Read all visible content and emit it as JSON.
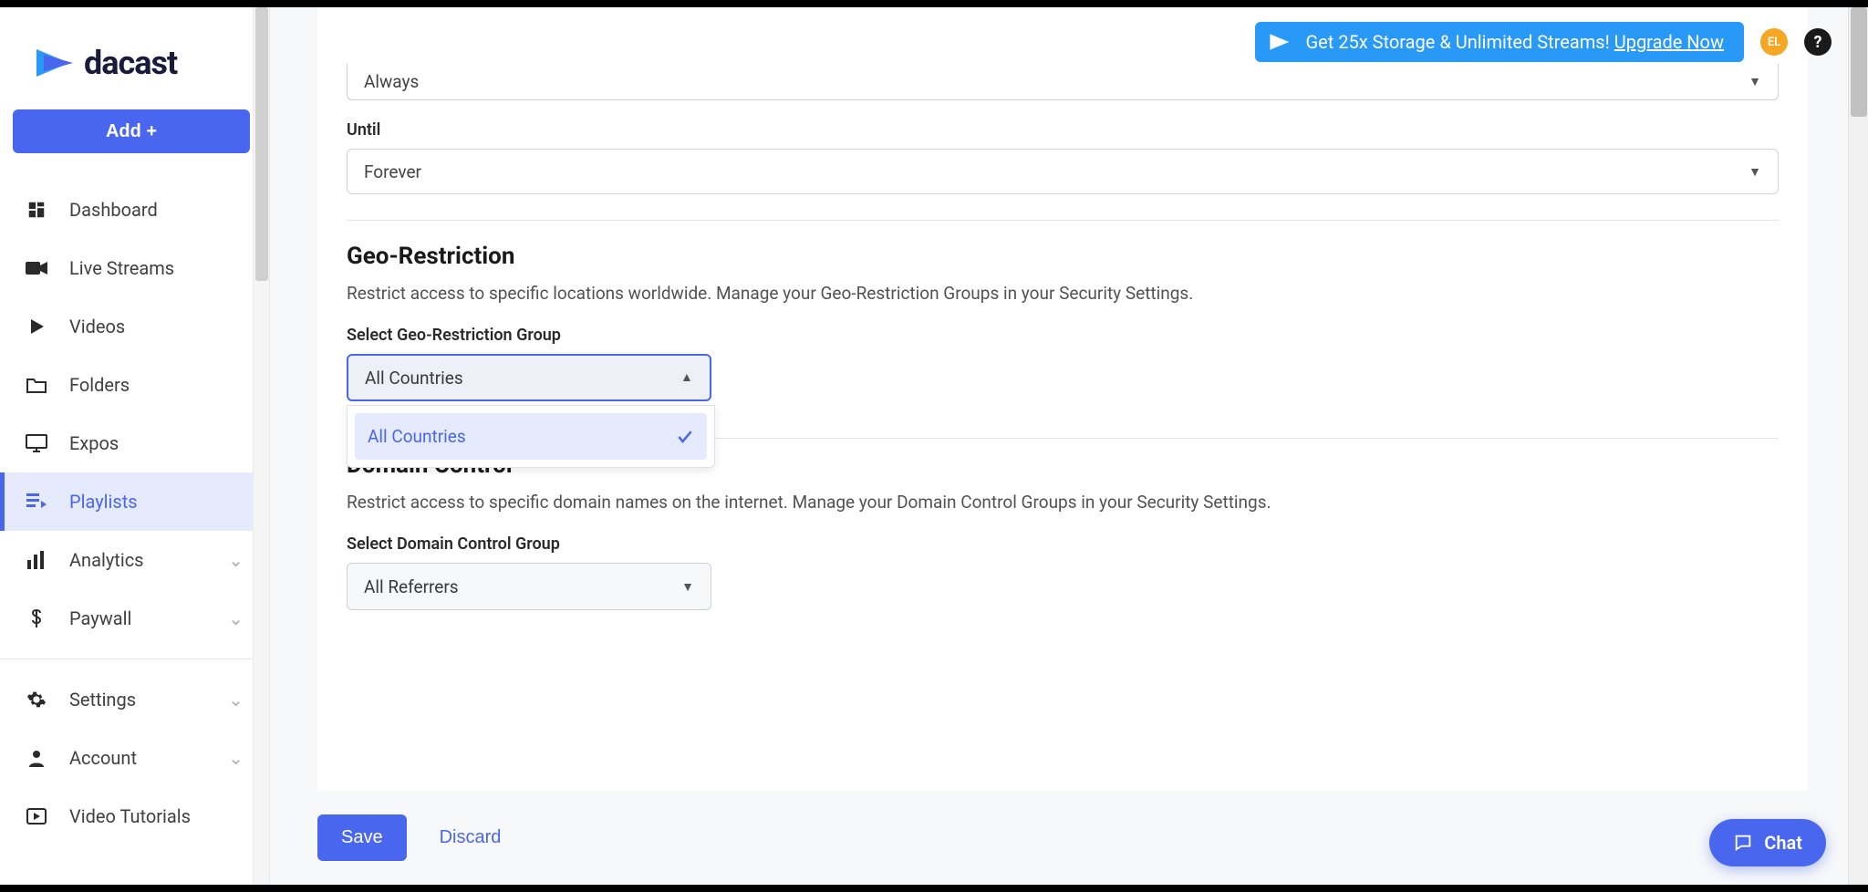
{
  "brand": {
    "name": "dacast"
  },
  "sidebar": {
    "add_label": "Add +",
    "items": [
      {
        "label": "Dashboard"
      },
      {
        "label": "Live Streams"
      },
      {
        "label": "Videos"
      },
      {
        "label": "Folders"
      },
      {
        "label": "Expos"
      },
      {
        "label": "Playlists"
      },
      {
        "label": "Analytics"
      },
      {
        "label": "Paywall"
      }
    ],
    "secondary": [
      {
        "label": "Settings"
      },
      {
        "label": "Account"
      },
      {
        "label": "Video Tutorials"
      }
    ]
  },
  "topbar": {
    "promo_text": "Get 25x Storage & Unlimited Streams! ",
    "promo_link": "Upgrade Now",
    "avatar_initials": "EL"
  },
  "main": {
    "field_always": {
      "value": "Always"
    },
    "field_until": {
      "label": "Until",
      "value": "Forever"
    },
    "geo": {
      "title": "Geo-Restriction",
      "desc": "Restrict access to specific locations worldwide. Manage your Geo-Restriction Groups in your Security Settings.",
      "select_label": "Select Geo-Restriction Group",
      "selected": "All Countries",
      "options": [
        "All Countries"
      ]
    },
    "domain": {
      "title": "Domain Control",
      "desc": "Restrict access to specific domain names on the internet. Manage your Domain Control Groups in your Security Settings.",
      "select_label": "Select Domain Control Group",
      "selected": "All Referrers"
    }
  },
  "actions": {
    "save": "Save",
    "discard": "Discard"
  },
  "chat": {
    "label": "Chat"
  }
}
